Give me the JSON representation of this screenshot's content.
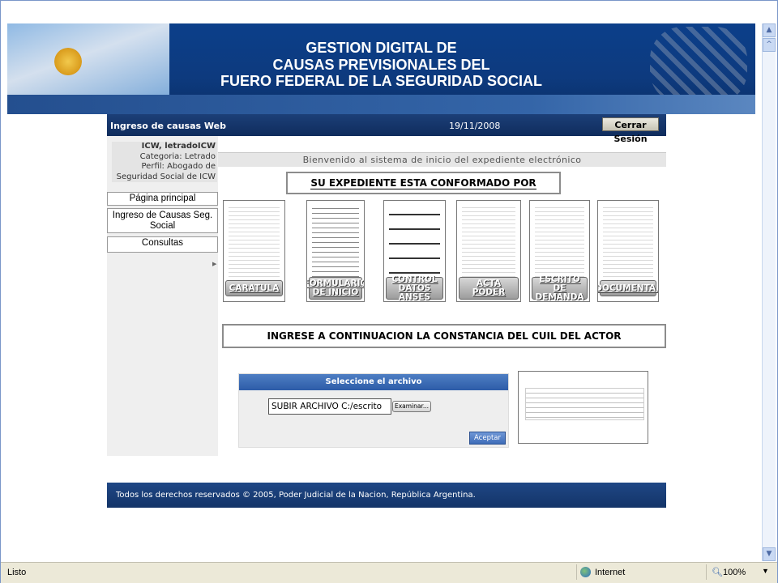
{
  "banner": {
    "title_lines": [
      "GESTION DIGITAL DE",
      "CAUSAS PREVISIONALES DEL",
      "FUERO FEDERAL DE LA SEGURIDAD SOCIAL"
    ]
  },
  "app": {
    "name": "Ingreso de causas Web",
    "date": "19/11/2008",
    "logout_label": "Cerrar Sesión"
  },
  "user": {
    "name": "ICW, letradoICW",
    "category": "Categoria: Letrado",
    "profile": "Perfil: Abogado de",
    "org": "Seguridad Social de ICW"
  },
  "nav": {
    "items": [
      {
        "label": "Página principal"
      },
      {
        "label": "Ingreso de Causas Seg. Social"
      },
      {
        "label": "Consultas"
      }
    ]
  },
  "content": {
    "welcome": "Bienvenido al sistema de inicio del expediente electrónico",
    "expediente_title": "SU EXPEDIENTE ESTA CONFORMADO POR",
    "cards": [
      {
        "label": "CARATULA"
      },
      {
        "label": "FORMULARIO DE INICIO"
      },
      {
        "label": "CONTROL DATOS ANSES"
      },
      {
        "label": "ACTA PODER"
      },
      {
        "label": "ESCRITO DE DEMANDA"
      },
      {
        "label": "DOCUMENTAL"
      }
    ],
    "cuil_instruction": "INGRESE A CONTINUACION LA CONSTANCIA DEL CUIL DEL ACTOR"
  },
  "upload": {
    "header": "Seleccione el archivo",
    "file_value": "SUBIR ARCHIVO C:/escrito",
    "browse_label": "Examinar...",
    "accept_label": "Aceptar"
  },
  "footer": {
    "text": "Todos los derechos reservados © 2005, Poder Judicial de la Nacion, República Argentina."
  },
  "status": {
    "left": "Listo",
    "zone": "Internet",
    "zoom": "100%"
  },
  "colors": {
    "banner": "#0c3f8a",
    "app_header": "#1c3f78",
    "upload_header": "#4e7ec3"
  }
}
